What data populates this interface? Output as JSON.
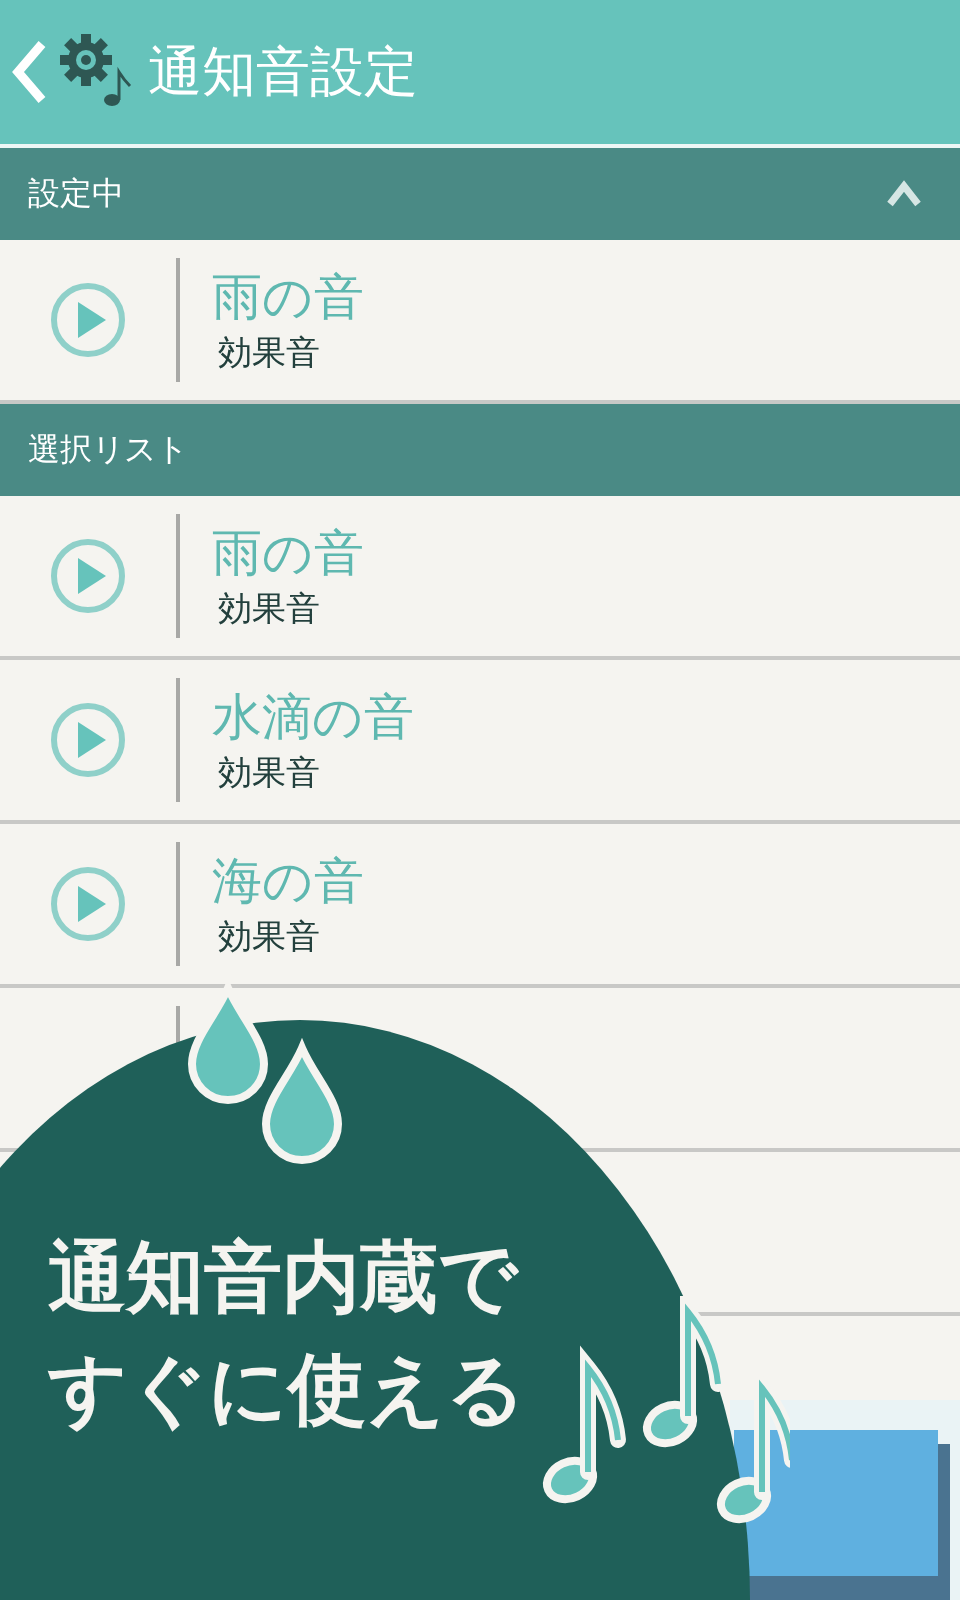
{
  "app_bar": {
    "title": "通知音設定"
  },
  "current_section": {
    "label": "設定中",
    "expanded": true,
    "items": [
      {
        "title": "雨の音",
        "subtitle": "効果音"
      }
    ]
  },
  "list_section": {
    "label": "選択リスト",
    "items": [
      {
        "title": "雨の音",
        "subtitle": "効果音"
      },
      {
        "title": "水滴の音",
        "subtitle": "効果音"
      },
      {
        "title": "海の音",
        "subtitle": "効果音"
      }
    ]
  },
  "promo": {
    "lines": [
      "通知音内蔵で",
      "すぐに使える"
    ]
  }
}
